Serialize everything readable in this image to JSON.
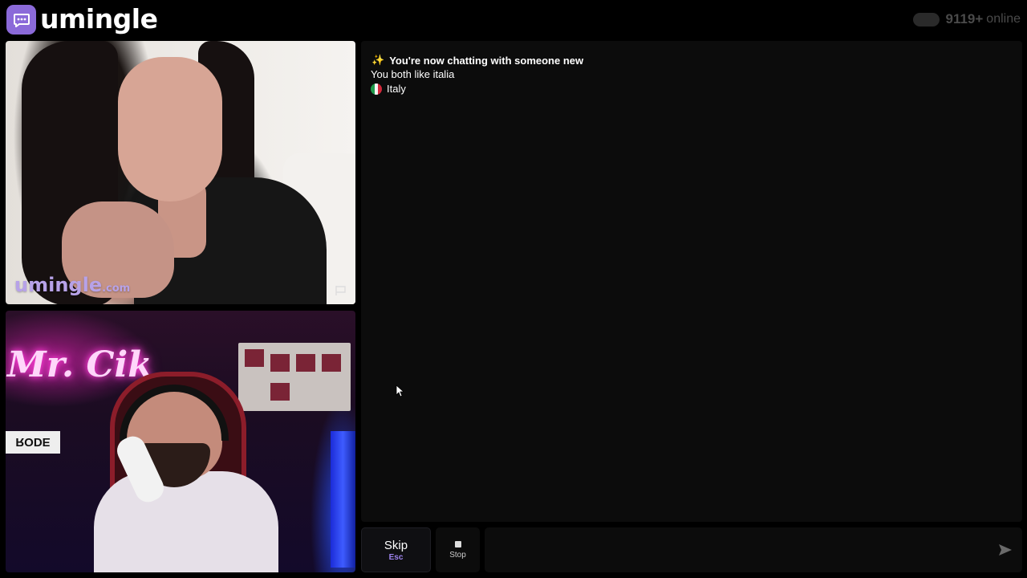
{
  "header": {
    "brand": "umingle",
    "online_count": "9119+",
    "online_label": "online"
  },
  "stranger_video": {
    "watermark_main": "umingle",
    "watermark_suffix": ".com"
  },
  "self_video": {
    "neon_sign": "Mr. Cik",
    "mic_brand": "RODE"
  },
  "chat": {
    "system_line": "You're now chatting with someone new",
    "common_interest": "You both like italia",
    "country": "Italy"
  },
  "controls": {
    "skip_label": "Skip",
    "skip_key": "Esc",
    "stop_label": "Stop",
    "message_placeholder": ""
  },
  "colors": {
    "accent": "#8b6ad9",
    "watermark": "#b7a2e8",
    "skip_key": "#9e83ee"
  }
}
